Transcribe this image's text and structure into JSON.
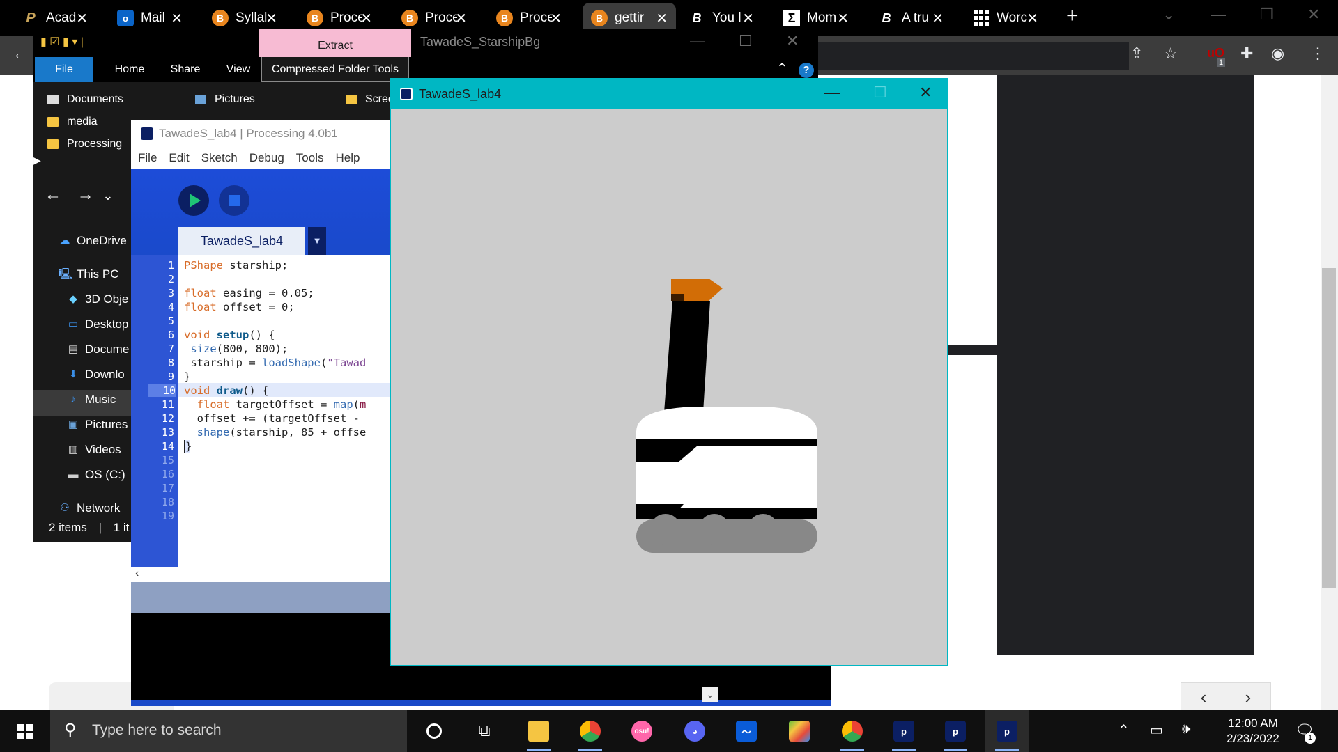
{
  "browser": {
    "tabs": [
      {
        "label": "Acad",
        "icon": "purdue-icon",
        "active": false
      },
      {
        "label": "Mail",
        "icon": "outlook-icon",
        "active": false
      },
      {
        "label": "Syllal",
        "icon": "brightspace-icon",
        "active": false
      },
      {
        "label": "Proce",
        "icon": "brightspace-icon",
        "active": false
      },
      {
        "label": "Proce",
        "icon": "brightspace-icon",
        "active": false
      },
      {
        "label": "Proce",
        "icon": "brightspace-icon",
        "active": false
      },
      {
        "label": "gettir",
        "icon": "brightspace-icon",
        "active": true
      },
      {
        "label": "You l",
        "icon": "bold-b-icon",
        "active": false
      },
      {
        "label": "Mom",
        "icon": "sigma-icon",
        "active": false
      },
      {
        "label": "A tru",
        "icon": "bold-b-icon",
        "active": false
      },
      {
        "label": "Worc",
        "icon": "wordle-icon",
        "active": false
      }
    ],
    "extension_badge": "1"
  },
  "explorer": {
    "title": "TawadeS_StarshipBg",
    "contextual_tab": "Extract",
    "ribbon_tabs": {
      "file": "File",
      "home": "Home",
      "share": "Share",
      "view": "View",
      "tools": "Compressed Folder Tools"
    },
    "help": "?",
    "quick_access": {
      "documents": "Documents",
      "pictures": "Pictures",
      "screenshots": "Scree",
      "media": "media",
      "processing": "Processing"
    },
    "nav": {
      "onedrive": "OneDrive",
      "this_pc": "This PC",
      "objects3d": "3D Obje",
      "desktop": "Desktop",
      "documents": "Docume",
      "downloads": "Downlo",
      "music": "Music",
      "pictures": "Pictures",
      "videos": "Videos",
      "os": "OS (C:)",
      "network": "Network"
    },
    "status_items": "2 items",
    "status_selected": "1 it"
  },
  "ide": {
    "title": "TawadeS_lab4 | Processing 4.0b1",
    "menu": {
      "file": "File",
      "edit": "Edit",
      "sketch": "Sketch",
      "debug": "Debug",
      "tools": "Tools",
      "help": "Help"
    },
    "tab": "TawadeS_lab4",
    "tab_arrow": "▼",
    "code": {
      "l1_type": "PShape",
      "l1_rest": " starship;",
      "l3_type": "float",
      "l3_rest": " easing = 0.05;",
      "l4_type": "float",
      "l4_rest": " offset = 0;",
      "l6_type": "void",
      "l6_fn": "setup",
      "l6_rest": "() {",
      "l7_call": "size",
      "l7_rest": "(800, 800);",
      "l8_a": " starship = ",
      "l8_call": "loadShape",
      "l8_b": "(",
      "l8_str": "\"Tawad",
      "l9": "}",
      "l10_type": "void",
      "l10_fn": "draw",
      "l10_rest": "() {",
      "l11_type": "float",
      "l11_a": " targetOffset = ",
      "l11_call": "map",
      "l11_b": "(",
      "l11_c": "m",
      "l12": "  offset += (targetOffset -",
      "l13_call": "shape",
      "l13_rest": "(starship, 85 + offse",
      "l14": "}"
    }
  },
  "sketch_window": {
    "title": "TawadeS_lab4"
  },
  "taskbar": {
    "search_placeholder": "Type here to search",
    "time": "12:00 AM",
    "date": "2/23/2022",
    "notification_count": "1"
  }
}
